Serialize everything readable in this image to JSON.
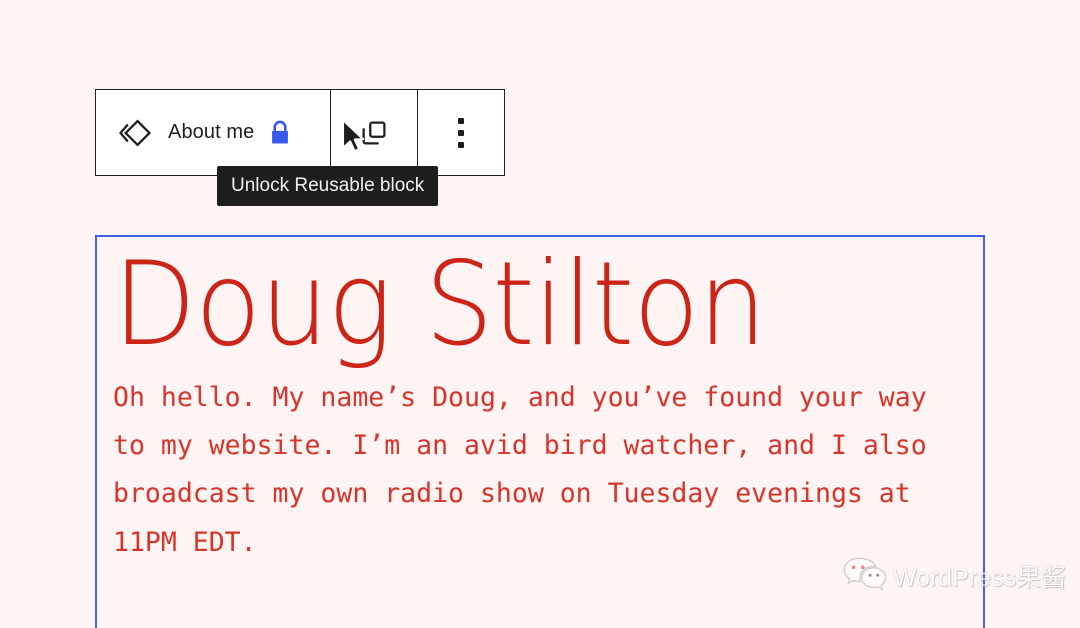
{
  "page": {
    "background_color": "#fdf4f3"
  },
  "toolbar": {
    "block_icon_name": "reusable-block-icon",
    "block_label": "About me",
    "lock_icon_name": "lock-icon",
    "lock_color": "#3858e9",
    "copy_button_label": "Copy",
    "copy_icon_name": "copy-icon",
    "options_button_label": "Options",
    "options_icon_name": "more-vertical-icon"
  },
  "tooltip": {
    "text": "Unlock Reusable block"
  },
  "cursor": {
    "icon_name": "arrow-pointer-cursor"
  },
  "block": {
    "selection_color": "#4060e8",
    "title": "Doug Stilton",
    "title_color": "#cd2418",
    "paragraph": "Oh hello. My name’s Doug, and you’ve found your way to my website. I’m an avid bird watcher, and I also broadcast my own radio show on Tuesday evenings at 11PM EDT.",
    "paragraph_color": "#d8342a"
  },
  "watermark": {
    "logo_name": "wechat-logo",
    "text": "WordPress果酱"
  }
}
